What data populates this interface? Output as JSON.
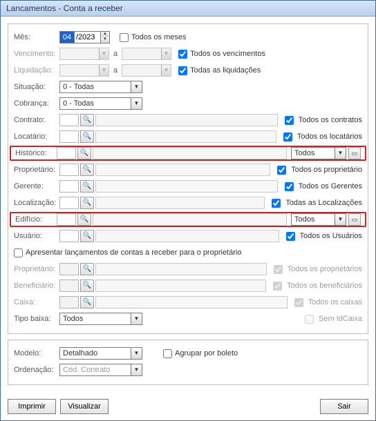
{
  "title": "Lancamentos - Conta a receber",
  "mes": {
    "label": "Mês:",
    "month": "04",
    "year": "/2023",
    "all_label": "Todos os meses"
  },
  "vencimento": {
    "label": "Vencimento:",
    "a": "a",
    "all_label": "Todos os vencimentos"
  },
  "liquidacao": {
    "label": "Liquidação:",
    "a": "a",
    "all_label": "Todas as liquidações"
  },
  "situacao": {
    "label": "Situação:",
    "value": "0 - Todas"
  },
  "cobranca": {
    "label": "Cobrança:",
    "value": "0 - Todas"
  },
  "contrato": {
    "label": "Contrato:",
    "all_label": "Todos os contratos"
  },
  "locatario": {
    "label": "Locatário:",
    "all_label": "Todos os locatários"
  },
  "historico": {
    "label": "Histórico:",
    "combo": "Todos"
  },
  "proprietario1": {
    "label": "Proprietário:",
    "all_label": "Todos os proprietário"
  },
  "gerente": {
    "label": "Gerente:",
    "all_label": "Todos os Gerentes"
  },
  "localizacao": {
    "label": "Localização:",
    "all_label": "Todas as Localizações"
  },
  "edificio": {
    "label": "Edifício:",
    "combo": "Todos"
  },
  "usuario": {
    "label": "Usuário:",
    "all_label": "Todos os Usuários"
  },
  "apresentar": {
    "label": "Apresentar lançamentos de contas a receber para o proprietário"
  },
  "proprietario2": {
    "label": "Proprietário:",
    "all_label": "Todos os proprietários"
  },
  "beneficiario": {
    "label": "Beneficiário:",
    "all_label": "Todos os beneficiários"
  },
  "caixa": {
    "label": "Caixa:",
    "all_label": "Todos os caixas",
    "semid_label": "Sem IdCaixa"
  },
  "tipobaixa": {
    "label": "Tipo baixa:",
    "value": "Todos"
  },
  "modelo": {
    "label": "Modelo:",
    "value": "Detalhado",
    "agrupar": "Agrupar por boleto"
  },
  "ordenacao": {
    "label": "Ordenação:",
    "value": "Cód. Contrato"
  },
  "buttons": {
    "imprimir": "Imprimir",
    "visualizar": "Visualizar",
    "sair": "Sair"
  }
}
